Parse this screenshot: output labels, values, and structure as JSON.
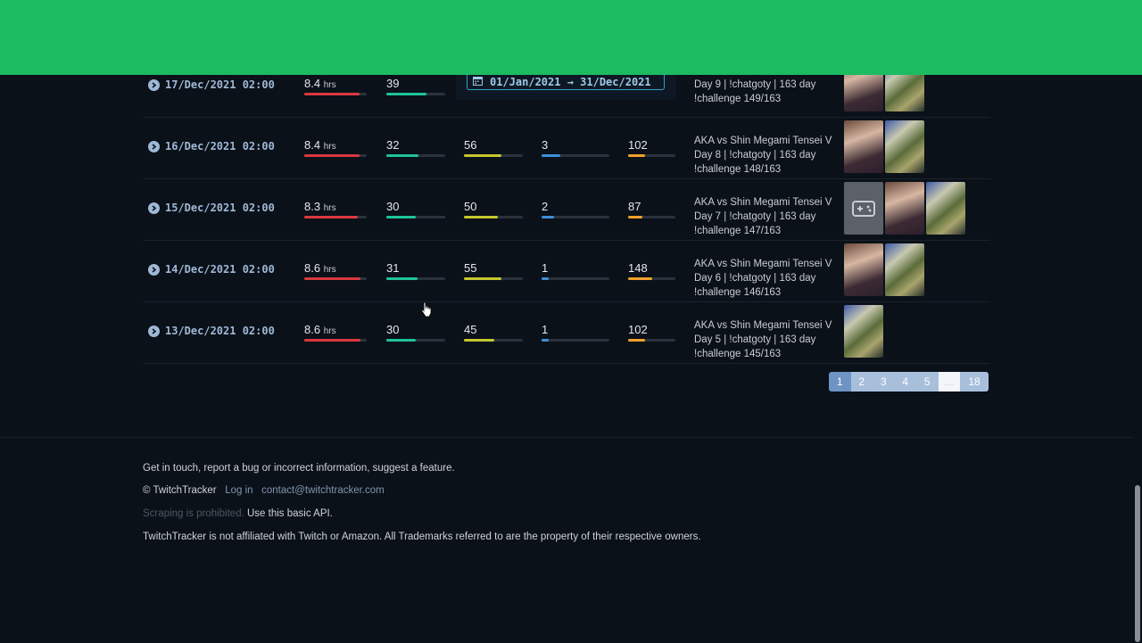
{
  "date_range": {
    "label": "01/Jan/2021 → 31/Dec/2021"
  },
  "rows": [
    {
      "date": "17/Dec/2021 02:00",
      "hours": "8.4",
      "hours_unit": "hrs",
      "c1": "39",
      "c2": "",
      "c3": "",
      "c4": "",
      "title": "Day 9 | !chatgoty | 163 day !challenge 149/163",
      "thumbs": [
        "chatgoty-thumb",
        "smt-thumb"
      ],
      "fills": {
        "hours": 0.88,
        "c1": 0.68
      }
    },
    {
      "date": "16/Dec/2021 02:00",
      "hours": "8.4",
      "hours_unit": "hrs",
      "c1": "32",
      "c2": "56",
      "c3": "3",
      "c4": "102",
      "title": "AKA vs Shin Megami Tensei V Day 8 | !chatgoty | 163 day !challenge 148/163",
      "thumbs": [
        "chatgoty-thumb",
        "smt-thumb"
      ],
      "fills": {
        "hours": 0.88,
        "c1": 0.55,
        "c2": 0.64,
        "c3": 0.28,
        "c4": 0.35
      }
    },
    {
      "date": "15/Dec/2021 02:00",
      "hours": "8.3",
      "hours_unit": "hrs",
      "c1": "30",
      "c2": "50",
      "c3": "2",
      "c4": "87",
      "title": "AKA vs Shin Megami Tensei V Day 7 | !chatgoty | 163 day !challenge 147/163",
      "thumbs": [
        "placeholder-thumb",
        "chatgoty-thumb",
        "smt-thumb"
      ],
      "fills": {
        "hours": 0.86,
        "c1": 0.5,
        "c2": 0.57,
        "c3": 0.18,
        "c4": 0.3
      }
    },
    {
      "date": "14/Dec/2021 02:00",
      "hours": "8.6",
      "hours_unit": "hrs",
      "c1": "31",
      "c2": "55",
      "c3": "1",
      "c4": "148",
      "title": "AKA vs Shin Megami Tensei V Day 6 | !chatgoty | 163 day !challenge 146/163",
      "thumbs": [
        "chatgoty-thumb",
        "smt-thumb"
      ],
      "fills": {
        "hours": 0.9,
        "c1": 0.53,
        "c2": 0.63,
        "c3": 0.1,
        "c4": 0.5
      }
    },
    {
      "date": "13/Dec/2021 02:00",
      "hours": "8.6",
      "hours_unit": "hrs",
      "c1": "30",
      "c2": "45",
      "c3": "1",
      "c4": "102",
      "title": "AKA vs Shin Megami Tensei V Day 5 | !chatgoty | 163 day !challenge 145/163",
      "thumbs": [
        "smt-thumb"
      ],
      "fills": {
        "hours": 0.9,
        "c1": 0.5,
        "c2": 0.52,
        "c3": 0.1,
        "c4": 0.35
      }
    }
  ],
  "colors": {
    "hours": "#d9393f",
    "c1": "#1fc39a",
    "c2": "#c5c72e",
    "c3": "#3c8fd9",
    "c4": "#f0a22b"
  },
  "pagination": {
    "pages": [
      "1",
      "2",
      "3",
      "4",
      "5",
      "...",
      "18"
    ],
    "current": "1"
  },
  "footer": {
    "contact_line": "Get in touch, report a bug or incorrect information, suggest a feature.",
    "copyright": "© TwitchTracker",
    "login": "Log in",
    "email": "contact@twitchtracker.com",
    "scraping": "Scraping is prohibited.",
    "api": "Use this basic API.",
    "disclaimer": "TwitchTracker is not affiliated with Twitch or Amazon. All Trademarks referred to are the property of their respective owners."
  }
}
